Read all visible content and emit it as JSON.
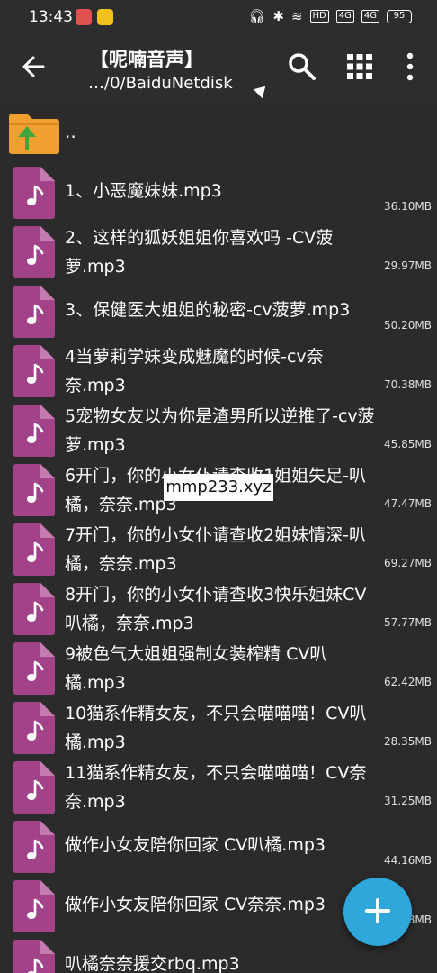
{
  "status_bar": {
    "time": "13:43",
    "right_icons": [
      "headphones-icon",
      "bluetooth-icon",
      "wifi-icon",
      "hd-icon",
      "signal-4g-icon",
      "signal-4g-icon"
    ],
    "hd_label": "HD",
    "net1": "4G",
    "net2": "4G",
    "battery": "95"
  },
  "app_bar": {
    "title": "【呢喃音声】",
    "path": "…/0/BaiduNetdisk"
  },
  "parent_label": "..",
  "files": [
    {
      "name": "1、小恶魔妹妹.mp3",
      "size": "36.10MB"
    },
    {
      "name": "2、这样的狐妖姐姐你喜欢吗 -CV菠萝.mp3",
      "size": "29.97MB"
    },
    {
      "name": "3、保健医大姐姐的秘密-cv菠萝.mp3",
      "size": "50.20MB"
    },
    {
      "name": "4当萝莉学妹变成魅魔的时候-cv奈奈.mp3",
      "size": "70.38MB"
    },
    {
      "name": "5宠物女友以为你是渣男所以逆推了-cv菠萝.mp3",
      "size": "45.85MB"
    },
    {
      "name": "6开门，你的小女仆请查收1姐姐失足-叭橘，奈奈.mp3",
      "size": "47.47MB"
    },
    {
      "name": "7开门，你的小女仆请查收2姐妹情深-叭橘，奈奈.mp3",
      "size": "69.27MB"
    },
    {
      "name": "8开门，你的小女仆请查收3快乐姐妹CV叭橘，奈奈.mp3",
      "size": "57.77MB"
    },
    {
      "name": "9被色气大姐姐强制女装榨精 CV叭橘.mp3",
      "size": "62.42MB"
    },
    {
      "name": "10猫系作精女友，不只会喵喵喵！CV叭橘.mp3",
      "size": "28.35MB"
    },
    {
      "name": "11猫系作精女友，不只会喵喵喵！CV奈奈.mp3",
      "size": "31.25MB"
    },
    {
      "name": "做作小女友陪你回家 CV叭橘.mp3",
      "size": "44.16MB"
    },
    {
      "name": "做作小女友陪你回家 CV奈奈.mp3",
      "size": "…8MB"
    },
    {
      "name": "叭橘奈奈援交rbq.mp3",
      "size": ""
    }
  ],
  "watermark": "mmp233.xyz",
  "colors": {
    "background": "#2b2b2b",
    "file_icon": "#a2438a",
    "folder": "#f0a030",
    "fab": "#2fa7da"
  }
}
